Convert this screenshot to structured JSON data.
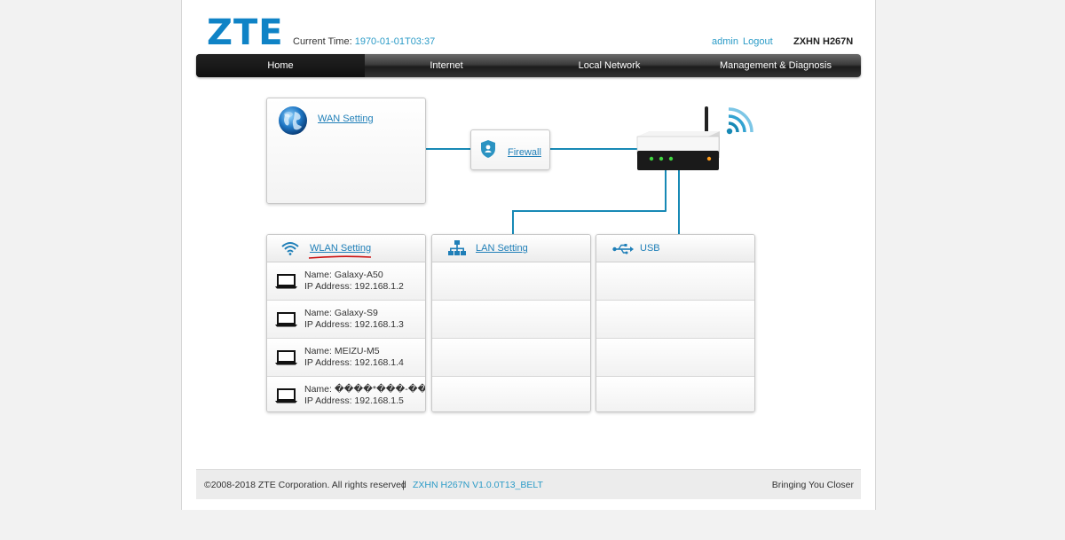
{
  "header": {
    "logo": "ZTE",
    "time_label": "Current Time:",
    "time_value": "1970-01-01T03:37",
    "user": "admin",
    "logout": "Logout",
    "model": "ZXHN H267N"
  },
  "nav": {
    "items": [
      "Home",
      "Internet",
      "Local Network",
      "Management & Diagnosis"
    ],
    "active": "Home"
  },
  "topology": {
    "wan": "WAN Setting",
    "firewall": "Firewall",
    "wlan": "WLAN Setting",
    "lan": "LAN Setting",
    "usb": "USB"
  },
  "wlan_devices": [
    {
      "name": "Name: Galaxy-A50",
      "ip": "IP Address: 192.168.1.2"
    },
    {
      "name": "Name: Galaxy-S9",
      "ip": "IP Address: 192.168.1.3"
    },
    {
      "name": "Name: MEIZU-M5",
      "ip": "IP Address: 192.168.1.4"
    },
    {
      "name": "Name: ����*���-��",
      "ip": "IP Address: 192.168.1.5"
    }
  ],
  "footer": {
    "copyright": "©2008-2018 ZTE Corporation. All rights reserved",
    "separator": "|",
    "firmware": "ZXHN H267N V1.0.0T13_BELT",
    "slogan": "Bringing You Closer"
  },
  "colors": {
    "accent": "#1f7fb8",
    "line": "#1789b5",
    "annotation": "#cc1111"
  },
  "icons": [
    "globe-icon",
    "shield-icon",
    "router-icon",
    "wifi-signal-icon",
    "wifi-icon",
    "network-icon",
    "usb-icon",
    "laptop-icon"
  ]
}
